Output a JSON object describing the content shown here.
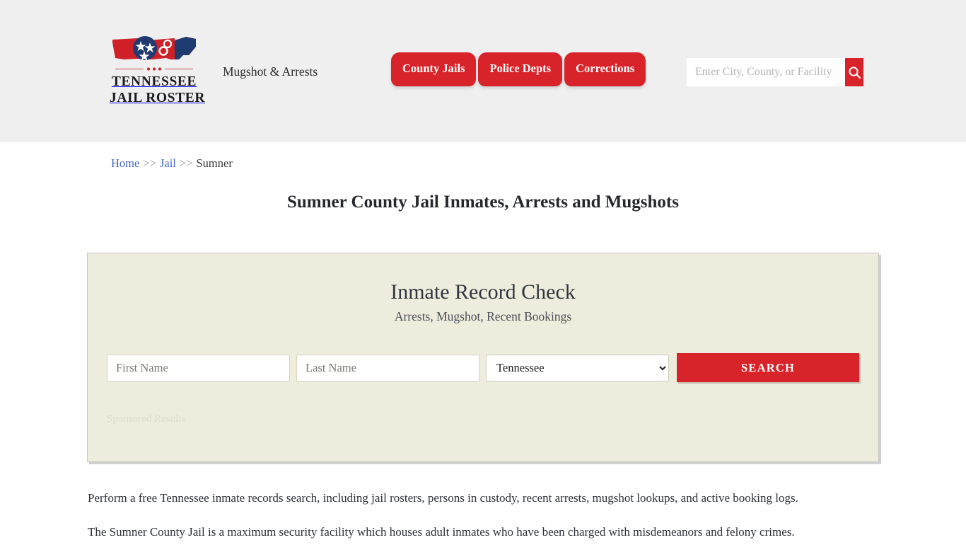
{
  "header": {
    "logo": {
      "line1": "TENNESSEE",
      "line2": "JAIL ROSTER",
      "icon_name": "tennessee-state-handcuffs-logo"
    },
    "tagline": "Mugshot & Arrests",
    "nav": [
      {
        "label": "County Jails"
      },
      {
        "label": "Police Depts"
      },
      {
        "label": "Corrections"
      }
    ],
    "search": {
      "placeholder": "Enter City, County, or Facility",
      "value": "",
      "button_icon": "search-icon"
    },
    "background_color": "#efefef",
    "accent_color": "#d8232a"
  },
  "breadcrumb": {
    "home": "Home",
    "sep1": ">>",
    "jail": "Jail",
    "sep2": ">>",
    "current": "Sumner"
  },
  "page_title": "Sumner County Jail Inmates, Arrests and Mugshots",
  "record_check": {
    "title": "Inmate Record Check",
    "subtitle": "Arrests, Mugshot, Recent Bookings",
    "first_name_placeholder": "First Name",
    "first_name_value": "",
    "last_name_placeholder": "Last Name",
    "last_name_value": "",
    "state_selected": "Tennessee",
    "state_options": [
      "Tennessee"
    ],
    "search_button": "SEARCH",
    "sponsored_label": "Sponsored Results",
    "panel_color": "#eeecdc",
    "button_color": "#d8232a"
  },
  "content": {
    "paragraph1": "Perform a free Tennessee inmate records search, including jail rosters, persons in custody, recent arrests, mugshot lookups, and active booking logs.",
    "paragraph2": "The Sumner County Jail is a maximum security facility which houses adult inmates who have been charged with misdemeanors and felony crimes."
  }
}
